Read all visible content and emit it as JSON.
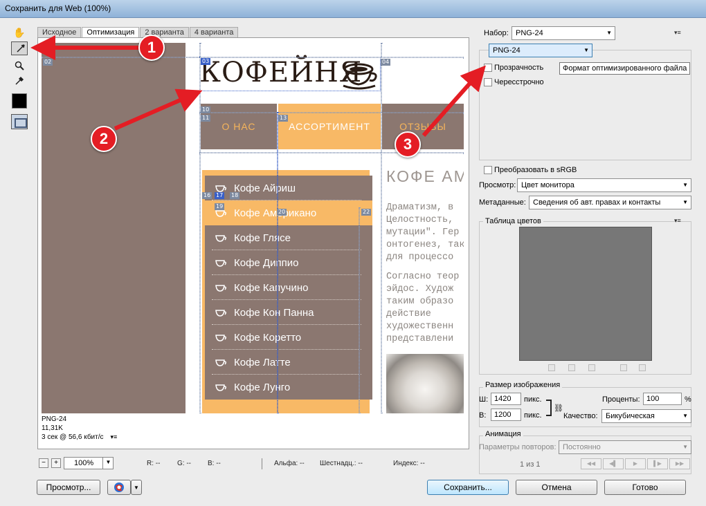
{
  "window": {
    "title": "Сохранить для Web (100%)"
  },
  "tabs": [
    "Исходное",
    "Оптимизация",
    "2 варианта",
    "4 варианта"
  ],
  "preview": {
    "logo": "КОФЕЙНЯ",
    "nav": [
      "О НАС",
      "АССОРТИМЕНТ",
      "ОТЗЫВЫ"
    ],
    "menu": [
      "Кофе Айриш",
      "Кофе Американо",
      "Кофе Глясе",
      "Кофе Диппио",
      "Кофе Капучино",
      "Кофе Кон Панна",
      "Кофе Коретто",
      "Кофе Латте",
      "Кофе Лунго"
    ],
    "heading": "КОФЕ АМ",
    "para1": [
      "Драматизм, в",
      "Целостность,",
      "мутации\". Гер",
      "онтогенез, так",
      "для процессо"
    ],
    "para2": [
      "Согласно теор",
      "эйдос. Худож",
      "таким образо",
      "действие",
      "художественн",
      "представлени"
    ],
    "slices": [
      "02",
      "03",
      "04",
      "10",
      "11",
      "13",
      "16",
      "17",
      "18",
      "19",
      "20",
      "22"
    ]
  },
  "status": {
    "format": "PNG-24",
    "size": "11,31K",
    "time": "3 сек @ 56,6 кбит/с"
  },
  "bottom": {
    "zoom": "100%",
    "r": "R: --",
    "g": "G: --",
    "b": "B: --",
    "alpha": "Альфа: --",
    "hex": "Шестнадц.: --",
    "index": "Индекс: --",
    "preview_btn": "Просмотр...",
    "save_btn": "Сохранить...",
    "cancel_btn": "Отмена",
    "done_btn": "Готово"
  },
  "panel": {
    "preset_label": "Набор:",
    "preset_value": "PNG-24",
    "format_value": "PNG-24",
    "transparency": "Прозрачность",
    "interlaced": "Чересстрочно",
    "tooltip": "Формат оптимизированного файла",
    "srgb": "Преобразовать в sRGB",
    "preview_label": "Просмотр:",
    "preview_value": "Цвет монитора",
    "meta_label": "Метаданные:",
    "meta_value": "Сведения об авт. правах и контакты",
    "color_table": "Таблица цветов",
    "image_size": "Размер изображения",
    "w_label": "Ш:",
    "w_value": "1420",
    "w_unit": "пикс.",
    "h_label": "В:",
    "h_value": "1200",
    "h_unit": "пикс.",
    "percent_label": "Проценты:",
    "percent_value": "100",
    "percent_unit": "%",
    "quality_label": "Качество:",
    "quality_value": "Бикубическая",
    "animation": "Анимация",
    "loop_label": "Параметры повторов:",
    "loop_value": "Постоянно",
    "frame": "1 из 1"
  },
  "callouts": [
    "1",
    "2",
    "3"
  ],
  "colors": {
    "brown": "#8b7770",
    "orange": "#f8b966",
    "accent_red": "#e41d24"
  }
}
